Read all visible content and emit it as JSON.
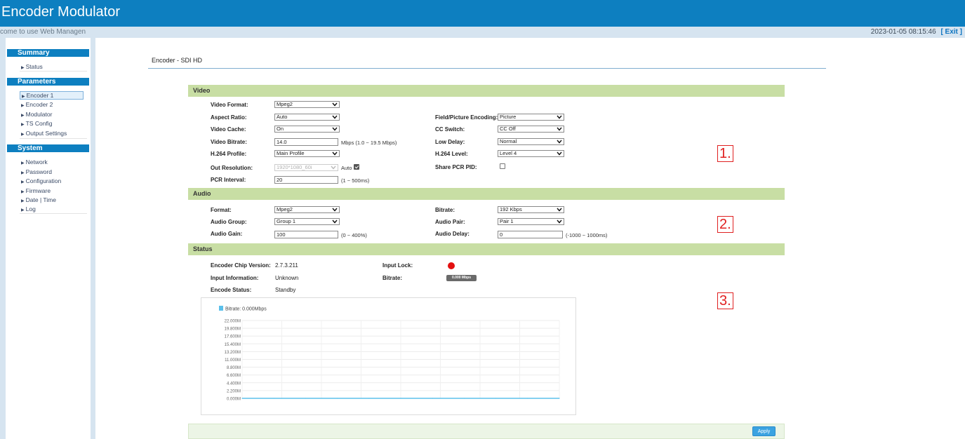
{
  "app": {
    "title": "Encoder Modulator",
    "welcome": "come to use Web Managen",
    "datetime": "2023-01-05 08:15:46",
    "exit_label": "[ Exit ]"
  },
  "sidebar": {
    "sections": [
      {
        "title": "Summary",
        "items": [
          {
            "label": "Status",
            "active": false
          }
        ]
      },
      {
        "title": "Parameters",
        "items": [
          {
            "label": "Encoder 1",
            "active": true
          },
          {
            "label": "Encoder 2",
            "active": false
          },
          {
            "label": "Modulator",
            "active": false
          },
          {
            "label": "TS Config",
            "active": false
          },
          {
            "label": "Output Settings",
            "active": false
          }
        ]
      },
      {
        "title": "System",
        "items": [
          {
            "label": "Network",
            "active": false
          },
          {
            "label": "Password",
            "active": false
          },
          {
            "label": "Configuration",
            "active": false
          },
          {
            "label": "Firmware",
            "active": false
          },
          {
            "label": "Date | Time",
            "active": false
          },
          {
            "label": "Log",
            "active": false
          }
        ]
      }
    ]
  },
  "page": {
    "title": "Encoder - SDI HD"
  },
  "video": {
    "section_title": "Video",
    "video_format": {
      "label": "Video Format:",
      "value": "Mpeg2"
    },
    "aspect_ratio": {
      "label": "Aspect Ratio:",
      "value": "Auto"
    },
    "video_cache": {
      "label": "Video Cache:",
      "value": "On"
    },
    "video_bitrate": {
      "label": "Video Bitrate:",
      "value": "14.0",
      "hint": "Mbps (1.0 ~ 19.5 Mbps)"
    },
    "h264_profile": {
      "label": "H.264 Profile:",
      "value": "Main Profile"
    },
    "out_resolution": {
      "label": "Out Resolution:",
      "value": "1920*1080_60i",
      "auto_label": "Auto",
      "auto_checked": true
    },
    "pcr_interval": {
      "label": "PCR Interval:",
      "value": "20",
      "hint": "(1 ~ 500ms)"
    },
    "field_picture": {
      "label": "Field/Picture Encoding:",
      "value": "Picture"
    },
    "cc_switch": {
      "label": "CC Switch:",
      "value": "CC Off"
    },
    "low_delay": {
      "label": "Low Delay:",
      "value": "Normal"
    },
    "h264_level": {
      "label": "H.264 Level:",
      "value": "Level 4"
    },
    "share_pcr": {
      "label": "Share PCR PID:",
      "checked": false
    }
  },
  "audio": {
    "section_title": "Audio",
    "format": {
      "label": "Format:",
      "value": "Mpeg2"
    },
    "audio_group": {
      "label": "Audio Group:",
      "value": "Group 1"
    },
    "audio_gain": {
      "label": "Audio Gain:",
      "value": "100",
      "hint": "(0 ~ 400%)"
    },
    "bitrate": {
      "label": "Bitrate:",
      "value": "192 Kbps"
    },
    "audio_pair": {
      "label": "Audio Pair:",
      "value": "Pair 1"
    },
    "audio_delay": {
      "label": "Audio Delay:",
      "value": "0",
      "hint": "(-1000 ~ 1000ms)"
    }
  },
  "status": {
    "section_title": "Status",
    "chip_version": {
      "label": "Encoder Chip Version:",
      "value": "2.7.3.211"
    },
    "input_info": {
      "label": "Input Information:",
      "value": "Unknown"
    },
    "encode_status": {
      "label": "Encode Status:",
      "value": "Standby"
    },
    "input_lock": {
      "label": "Input Lock:",
      "color": "#e31010"
    },
    "bitrate": {
      "label": "Bitrate:",
      "value": "0.000 Mbps"
    }
  },
  "annotations": {
    "one": "1.",
    "two": "2.",
    "three": "3."
  },
  "footer": {
    "apply_label": "Apply"
  },
  "chart_data": {
    "type": "line",
    "series": [
      {
        "name": "Bitrate: 0.000Mbps",
        "color": "#5bc0eb",
        "values": [
          0,
          0,
          0,
          0,
          0,
          0,
          0,
          0,
          0,
          0,
          0
        ]
      }
    ],
    "y_ticks": [
      "22.000M",
      "19.800M",
      "17.600M",
      "15.400M",
      "13.200M",
      "11.000M",
      "8.800M",
      "6.600M",
      "4.400M",
      "2.200M",
      "0.000M"
    ],
    "ylim": [
      0,
      22
    ],
    "grid": true,
    "legend": "top-left"
  }
}
